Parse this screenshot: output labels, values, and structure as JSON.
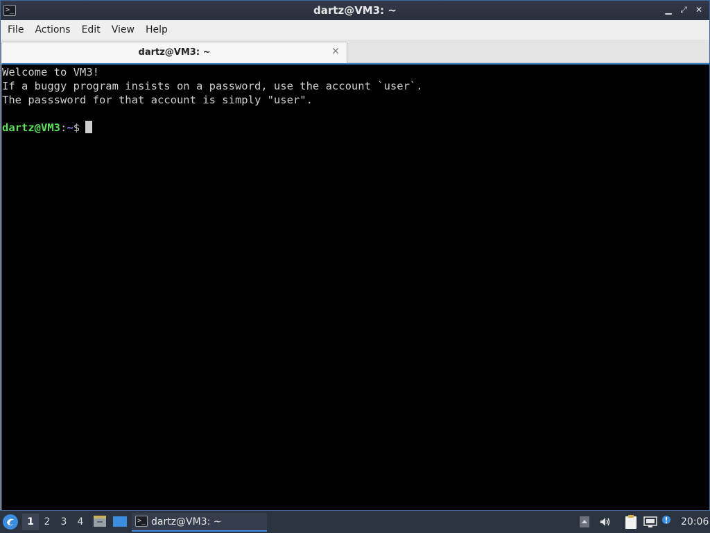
{
  "window": {
    "title": "dartz@VM3: ~",
    "app_icon_glyph": ">_",
    "buttons": {
      "minimize_glyph": "▁",
      "maximize_glyph": "⤢",
      "close_glyph": "✕"
    }
  },
  "menu": {
    "items": [
      "File",
      "Actions",
      "Edit",
      "View",
      "Help"
    ]
  },
  "tabs": [
    {
      "label": "dartz@VM3: ~",
      "close_glyph": "×"
    }
  ],
  "terminal": {
    "lines": [
      "Welcome to VM3!",
      "If a buggy program insists on a password, use the account `user`.",
      "The passsword for that account is simply \"user\".",
      ""
    ],
    "prompt": {
      "user_host": "dartz@VM3",
      "separator": ":",
      "path": "~",
      "symbol": "$"
    },
    "colors": {
      "background": "#000000",
      "text": "#cfcfcf",
      "user_host": "#5fe05f",
      "path": "#8a7cf0"
    }
  },
  "taskbar": {
    "workspaces": [
      "1",
      "2",
      "3",
      "4"
    ],
    "active_workspace": "1",
    "task_items": [
      {
        "label": "dartz@VM3: ~",
        "icon": "terminal-icon"
      }
    ],
    "tray_icons": [
      "tray-expand-icon",
      "volume-icon",
      "clipboard-icon",
      "network-icon"
    ],
    "clock": "20:06",
    "accent": "#3d8de0"
  }
}
